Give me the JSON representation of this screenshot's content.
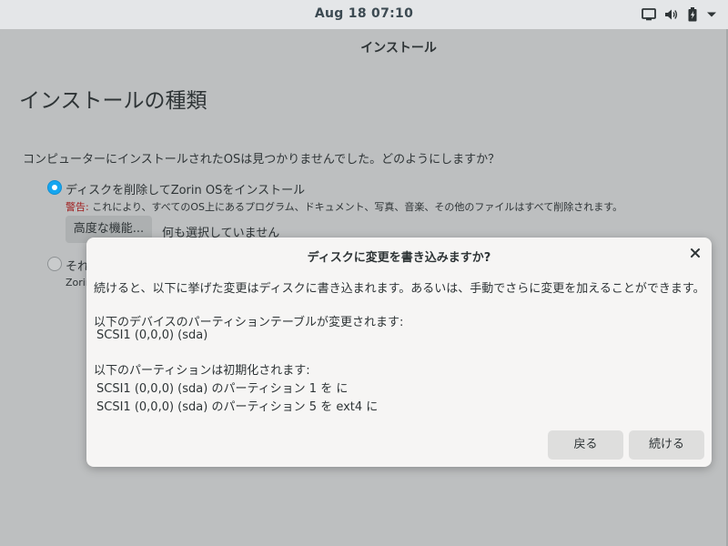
{
  "topbar": {
    "clock": "Aug 18  07:10",
    "icons": [
      "display-icon",
      "volume-icon",
      "battery-icon",
      "chevron-down-icon"
    ]
  },
  "window": {
    "title": "インストール",
    "page_title": "インストールの種類",
    "question": "コンピューターにインストールされたOSは見つかりませんでした。どのようにしますか？",
    "option1": {
      "label": "ディスクを削除してZorin OSをインストール",
      "selected": true,
      "warning_label": "警告:",
      "warning_text": " これにより、すべてのOS上にあるプログラム、ドキュメント、写真、音楽、その他のファイルはすべて削除されます。",
      "advanced_button": "高度な機能...",
      "advanced_status": "何も選択していません"
    },
    "option2": {
      "label": "それ",
      "subtext": "Zorin",
      "selected": false
    }
  },
  "dialog": {
    "title": "ディスクに変更を書き込みますか?",
    "intro": "続けると、以下に挙げた変更はディスクに書き込まれます。あるいは、手動でさらに変更を加えることができます。",
    "table_header": "以下のデバイスのパーティションテーブルが変更されます:",
    "table_device": "SCSI1 (0,0,0) (sda)",
    "format_header": "以下のパーティションは初期化されます:",
    "format_items": [
      "SCSI1 (0,0,0) (sda) のパーティション 1 を に",
      "SCSI1 (0,0,0) (sda) のパーティション 5 を ext4 に"
    ],
    "back_button": "戻る",
    "continue_button": "続ける"
  },
  "colors": {
    "accent": "#15a6f0",
    "warning": "#a01e1e",
    "background": "#bdbfc0",
    "dialog": "#f6f5f4"
  }
}
